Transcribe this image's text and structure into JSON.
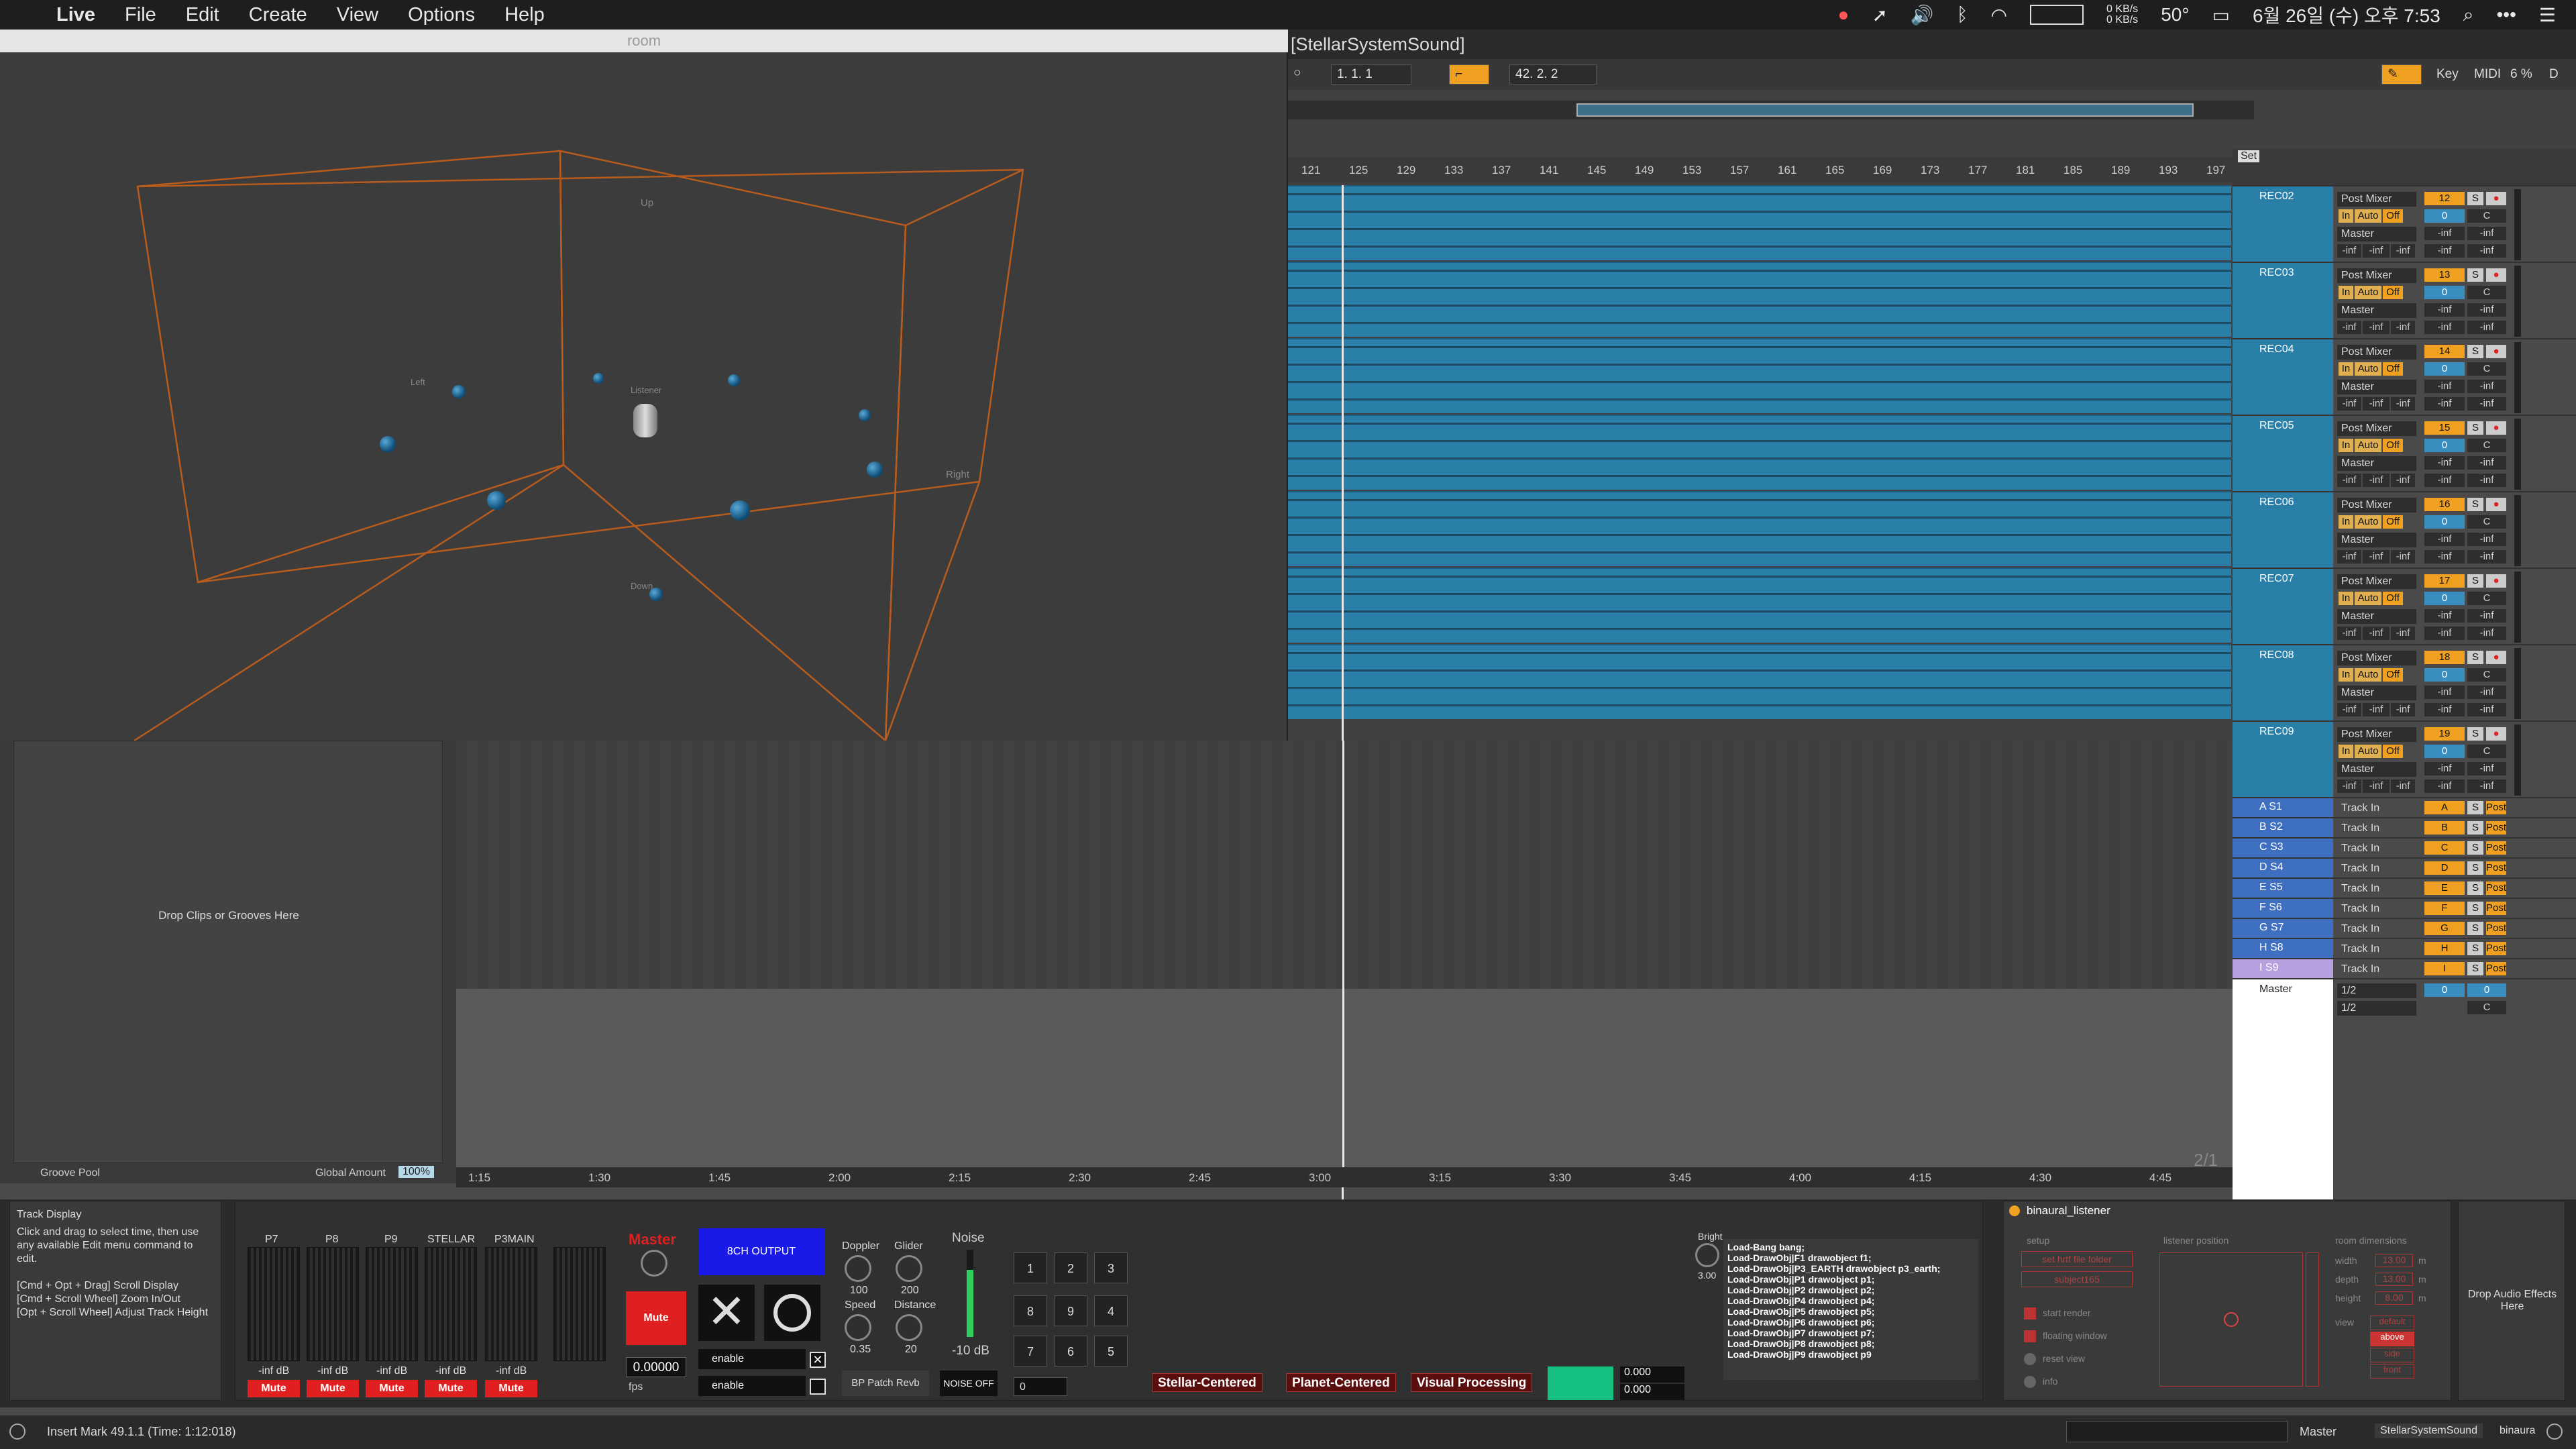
{
  "menubar": {
    "app": "Live",
    "items": [
      "File",
      "Edit",
      "Create",
      "View",
      "Options",
      "Help"
    ],
    "status": {
      "net_up": "0 KB/s",
      "net_down": "0 KB/s",
      "temp": "50°",
      "clock": "6월 26일 (수) 오후 7:53"
    }
  },
  "room": {
    "title": "room",
    "labels": {
      "up": "Up",
      "right": "Right",
      "left": "Left",
      "listener": "Listener",
      "down": "Down"
    }
  },
  "project": {
    "title": "[StellarSystemSound]"
  },
  "transport": {
    "pos1": "1. 1. 1",
    "pos2": "42. 2. 2",
    "key": "Key",
    "midi": "MIDI",
    "cpu": "6 %",
    "d": "D"
  },
  "ruler": [
    "121",
    "125",
    "129",
    "133",
    "137",
    "141",
    "145",
    "149",
    "153",
    "157",
    "161",
    "165",
    "169",
    "173",
    "177",
    "181",
    "185",
    "189",
    "193",
    "197"
  ],
  "set_label": "Set",
  "tracks": [
    {
      "name": "REC02",
      "mixer": "Post Mixer",
      "num": "12",
      "out": "Master"
    },
    {
      "name": "REC03",
      "mixer": "Post Mixer",
      "num": "13",
      "out": "Master"
    },
    {
      "name": "REC04",
      "mixer": "Post Mixer",
      "num": "14",
      "out": "Master"
    },
    {
      "name": "REC05",
      "mixer": "Post Mixer",
      "num": "15",
      "out": "Master"
    },
    {
      "name": "REC06",
      "mixer": "Post Mixer",
      "num": "16",
      "out": "Master"
    },
    {
      "name": "REC07",
      "mixer": "Post Mixer",
      "num": "17",
      "out": "Master"
    },
    {
      "name": "REC08",
      "mixer": "Post Mixer",
      "num": "18",
      "out": "Master"
    },
    {
      "name": "REC09",
      "mixer": "Post Mixer",
      "num": "19",
      "out": "Master"
    }
  ],
  "track_controls": {
    "in": "In",
    "auto": "Auto",
    "off": "Off",
    "zero": "0",
    "c": "C",
    "s": "S",
    "inf": "-inf"
  },
  "returns": [
    {
      "name": "A S1",
      "input": "Track In",
      "letter": "A"
    },
    {
      "name": "B S2",
      "input": "Track In",
      "letter": "B"
    },
    {
      "name": "C S3",
      "input": "Track In",
      "letter": "C"
    },
    {
      "name": "D S4",
      "input": "Track In",
      "letter": "D"
    },
    {
      "name": "E S5",
      "input": "Track In",
      "letter": "E"
    },
    {
      "name": "F S6",
      "input": "Track In",
      "letter": "F"
    },
    {
      "name": "G S7",
      "input": "Track In",
      "letter": "G"
    },
    {
      "name": "H S8",
      "input": "Track In",
      "letter": "H"
    },
    {
      "name": "I S9",
      "input": "Track In",
      "letter": "I"
    }
  ],
  "return_post": "Post",
  "master": {
    "name": "Master",
    "in1": "1/2",
    "in2": "1/2",
    "zero": "0",
    "c": "C"
  },
  "leftpanel": {
    "drop": "Drop Clips or Grooves Here",
    "groove_pool": "Groove Pool",
    "global_amount_label": "Global Amount",
    "global_amount": "100%"
  },
  "timeline2": [
    "1:15",
    "1:30",
    "1:45",
    "2:00",
    "2:15",
    "2:30",
    "2:45",
    "3:00",
    "3:15",
    "3:30",
    "3:45",
    "4:00",
    "4:15",
    "4:30",
    "4:45"
  ],
  "page_indicator": "2/1",
  "info": {
    "title": "Track Display",
    "text1": "Click and drag to select time, then use any available Edit menu command to edit.",
    "text2": "[Cmd + Opt + Drag] Scroll Display",
    "text3": "[Cmd + Scroll Wheel] Zoom In/Out",
    "text4": "[Opt + Scroll Wheel] Adjust Track Height"
  },
  "device": {
    "channels": [
      "P7",
      "P8",
      "P9",
      "STELLAR",
      "P3MAIN"
    ],
    "db": "-inf dB",
    "mute": "Mute",
    "master_label": "Master",
    "output_btn": "8CH OUTPUT",
    "doppler": "Doppler",
    "glider": "Glider",
    "doppler_val": "100",
    "glider_val": "200",
    "speed": "Speed",
    "distance": "Distance",
    "speed_val": "0.35",
    "distance_val": "20",
    "noise": "Noise",
    "noise_db": "-10 dB",
    "float": "0.00000",
    "fps": "fps",
    "enable1": "enable",
    "enable2": "enable",
    "patch": "BP Patch Revb",
    "noise_off": "NOISE OFF",
    "grid": [
      "1",
      "2",
      "3",
      "8",
      "9",
      "4",
      "7",
      "6",
      "5"
    ],
    "num0": "0",
    "stellar_centered": "Stellar-Centered",
    "planet_centered": "Planet-Centered",
    "visual": "Visual Processing",
    "v1": "0.000",
    "v2": "0.000",
    "bright": "Bright",
    "bright_val": "3.00",
    "msg": [
      "Load-Bang bang;",
      "Load-DrawObj|F1 drawobject f1;",
      "Load-DrawObj|P3_EARTH drawobject p3_earth;",
      "Load-DrawObj|P1 drawobject p1;",
      "Load-DrawObj|P2 drawobject p2;",
      "Load-DrawObj|P4 drawobject p4;",
      "Load-DrawObj|P5 drawobject p5;",
      "Load-DrawObj|P6 drawobject p6;",
      "Load-DrawObj|P7 drawobject p7;",
      "Load-DrawObj|P8 drawobject p8;",
      "Load-DrawObj|P9 drawobject p9"
    ]
  },
  "binaural": {
    "title": "binaural_listener",
    "setup": "setup",
    "hrtf": "set hrtf file folder",
    "subject": "subject165",
    "start": "start render",
    "floating": "floating window",
    "reset": "reset view",
    "info": "info",
    "pos_title": "listener position",
    "dims_title": "room dimensions",
    "width": "width",
    "depth": "depth",
    "height": "height",
    "width_v": "13.00",
    "depth_v": "13.00",
    "height_v": "8.00",
    "unit": "m",
    "view": "view",
    "views": [
      "default",
      "above",
      "side",
      "front"
    ]
  },
  "drop_fx": "Drop Audio Effects Here",
  "status": {
    "insert": "Insert Mark 49.1.1 (Time: 1:12:018)",
    "master": "Master",
    "device": "StellarSystemSound",
    "binaural": "binaura"
  }
}
